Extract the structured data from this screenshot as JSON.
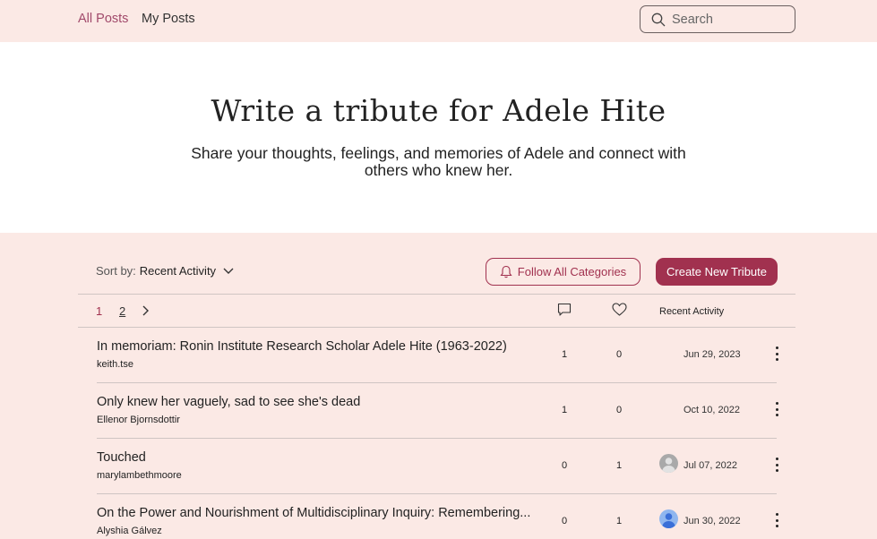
{
  "nav": {
    "tabs": [
      {
        "label": "All Posts",
        "active": true
      },
      {
        "label": "My Posts",
        "active": false
      }
    ],
    "search_placeholder": "Search"
  },
  "hero": {
    "title": "Write a tribute for Adele Hite",
    "subtitle": "Share your thoughts, feelings, and memories of Adele and connect with others who knew her."
  },
  "controls": {
    "sort_label": "Sort by:",
    "sort_value": "Recent Activity",
    "follow_label": "Follow All Categories",
    "create_label": "Create New Tribute"
  },
  "pagination": {
    "pages": [
      "1",
      "2"
    ],
    "current": "1"
  },
  "columns": {
    "comments_icon": "comment-icon",
    "likes_icon": "heart-icon",
    "recent_label": "Recent Activity"
  },
  "posts": [
    {
      "title": "In memoriam: Ronin Institute Research Scholar Adele Hite (1963-2022)",
      "author": "keith.tse",
      "comments": "1",
      "likes": "0",
      "date": "Jun 29, 2023",
      "avatar": null
    },
    {
      "title": "Only knew her vaguely, sad to see she's dead",
      "author": "Ellenor Bjornsdottir",
      "comments": "1",
      "likes": "0",
      "date": "Oct 10, 2022",
      "avatar": null
    },
    {
      "title": "Touched",
      "author": "marylambethmoore",
      "comments": "0",
      "likes": "1",
      "date": "Jul 07, 2022",
      "avatar": "gray-user-avatar"
    },
    {
      "title": "On the Power and Nourishment of Multidisciplinary Inquiry: Remembering...",
      "author": "Alyshia Gálvez",
      "comments": "0",
      "likes": "1",
      "date": "Jun 30, 2022",
      "avatar": "blue-user-avatar"
    }
  ],
  "colors": {
    "accent": "#a1314f",
    "active_tab": "#a14a6b",
    "background": "#fbe9e5",
    "hero_background": "#ffffff"
  }
}
